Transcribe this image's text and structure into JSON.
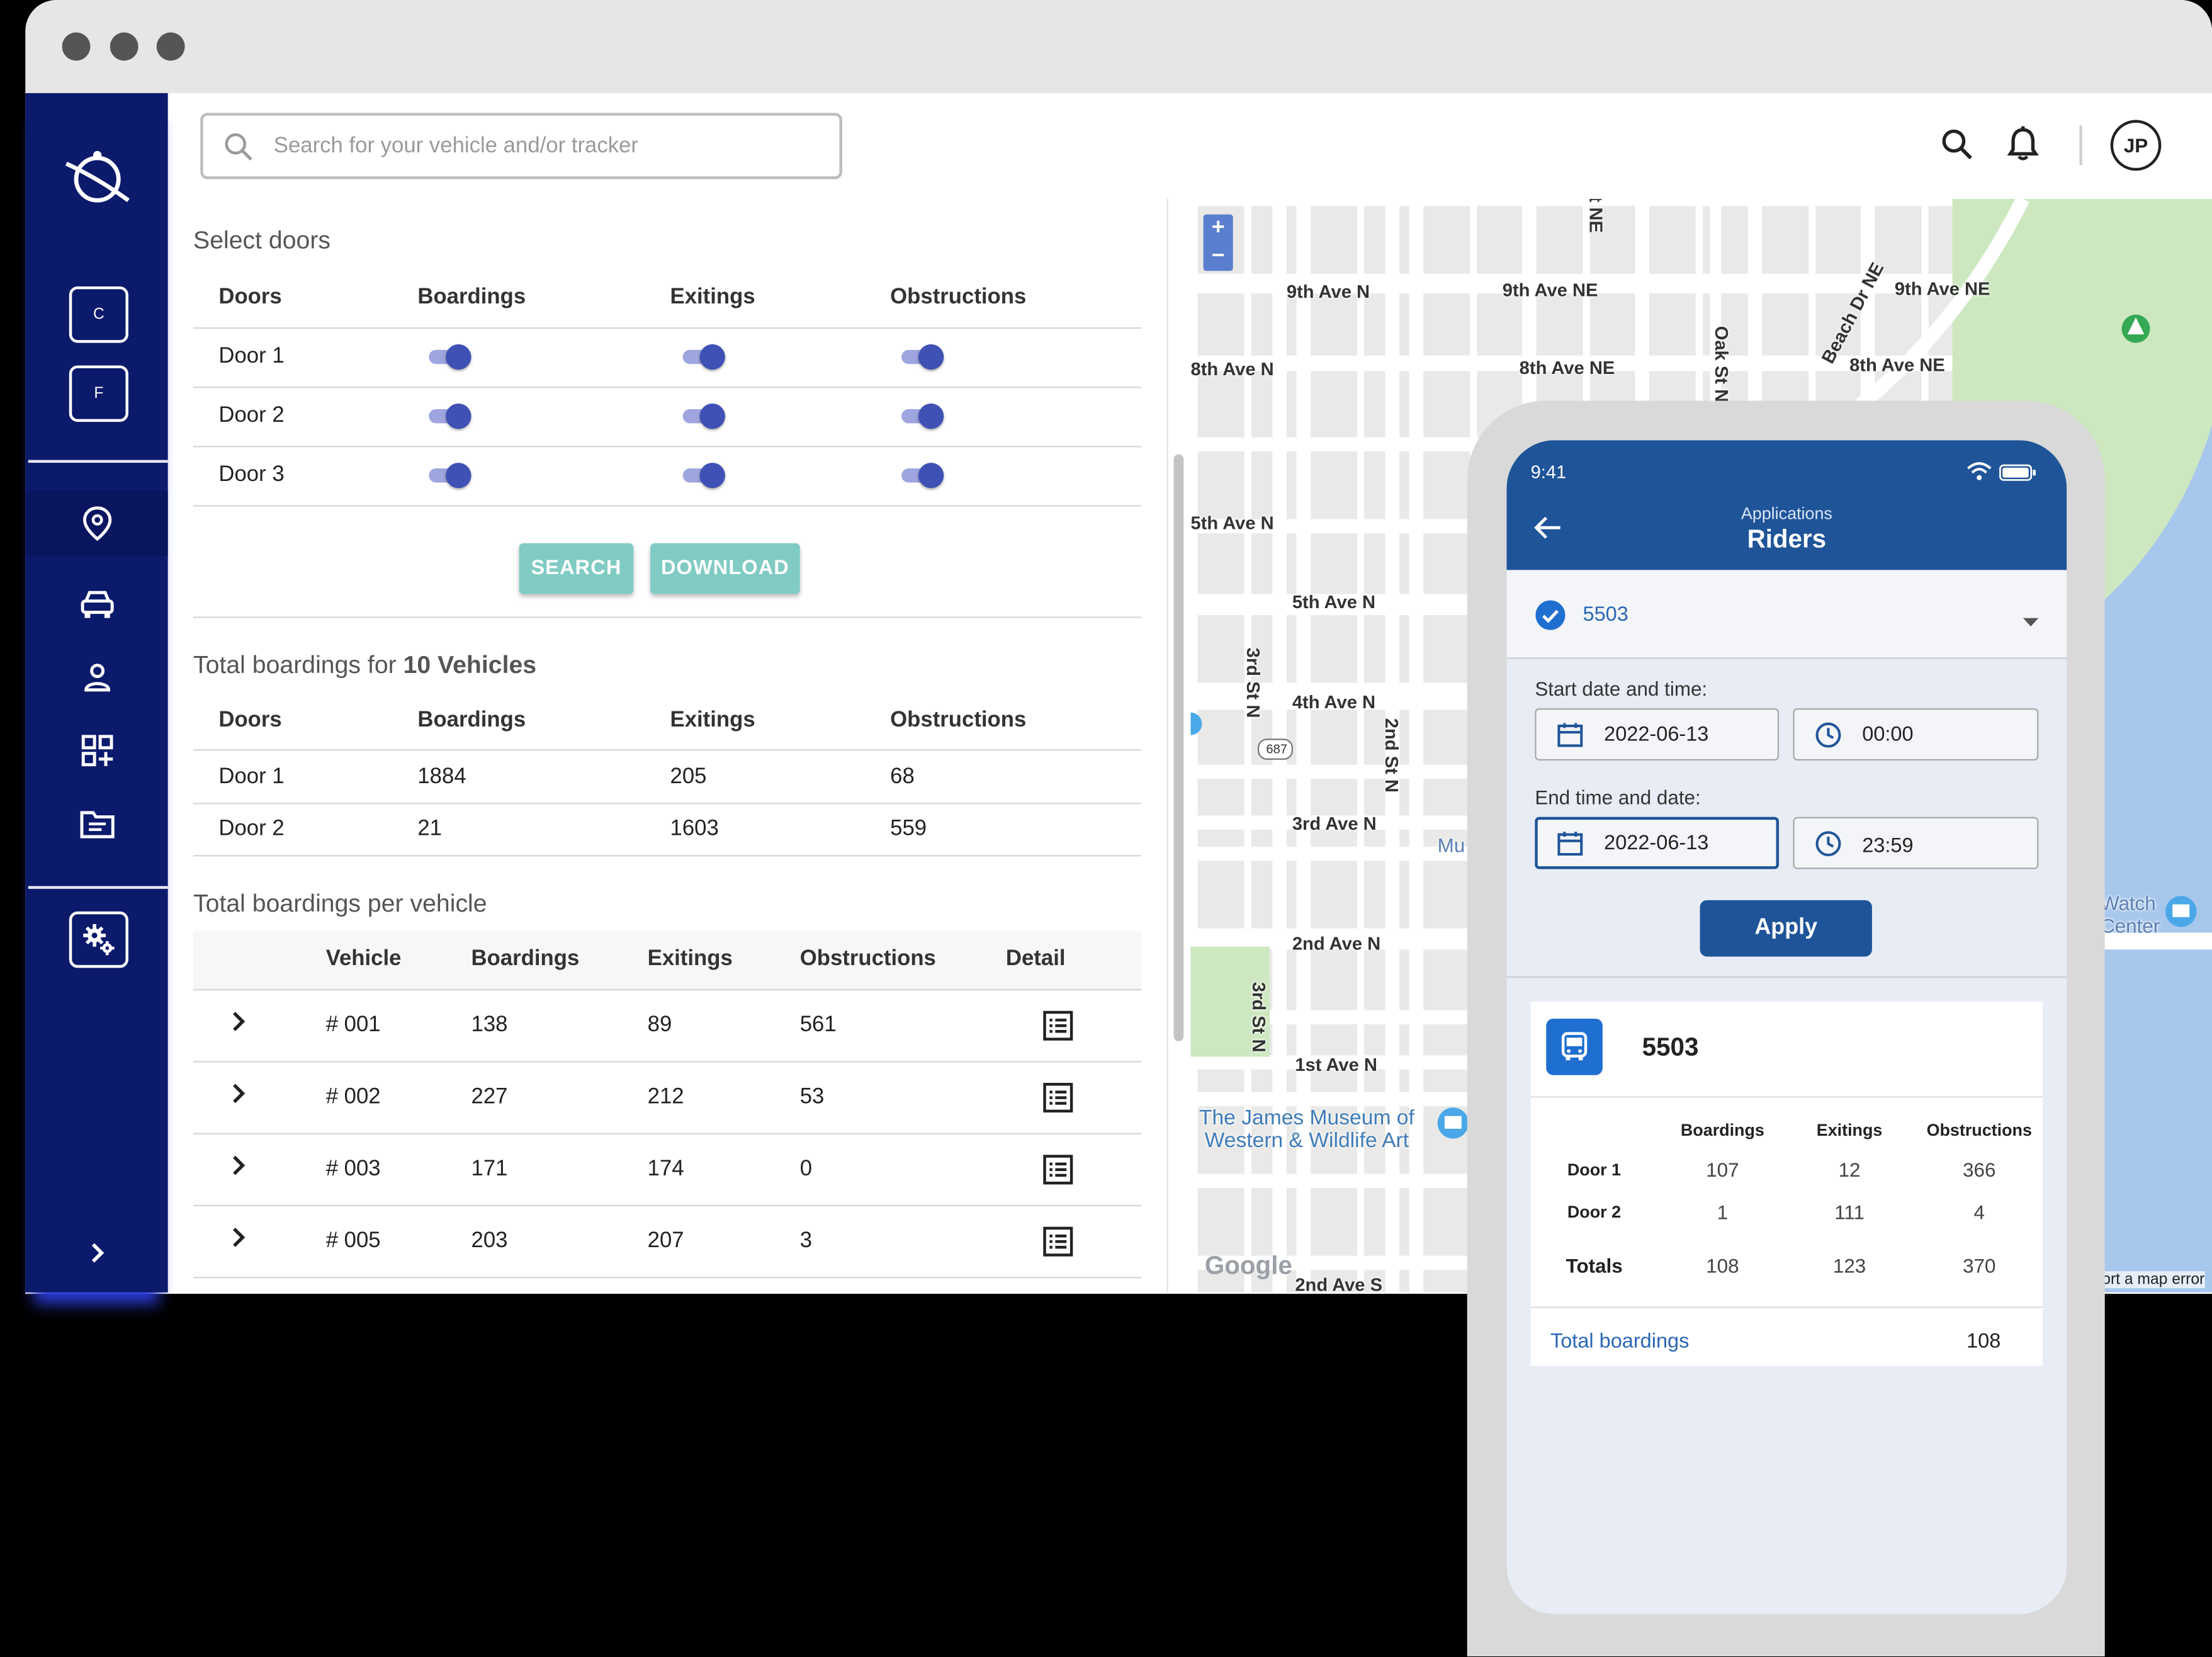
{
  "search": {
    "placeholder": "Search for your vehicle and/or tracker"
  },
  "user": {
    "initials": "JP"
  },
  "sidebar": {
    "box1": "C",
    "box2": "F",
    "items": [
      {
        "icon": "location-pin-icon"
      },
      {
        "icon": "car-icon"
      },
      {
        "icon": "person-icon"
      },
      {
        "icon": "apps-add-icon"
      },
      {
        "icon": "document-icon"
      }
    ],
    "settings_icon": "settings-gears-icon",
    "expand_icon": "chevron-right-icon"
  },
  "select_doors": {
    "title": "Select doors",
    "headers": [
      "Doors",
      "Boardings",
      "Exitings",
      "Obstructions"
    ],
    "rows": [
      {
        "door": "Door 1",
        "boardings": true,
        "exitings": true,
        "obstructions": true
      },
      {
        "door": "Door 2",
        "boardings": true,
        "exitings": true,
        "obstructions": true
      },
      {
        "door": "Door 3",
        "boardings": true,
        "exitings": true,
        "obstructions": true
      }
    ],
    "search_label": "SEARCH",
    "download_label": "DOWNLOAD"
  },
  "total_boardings": {
    "title_prefix": "Total boardings for ",
    "title_bold": "10 Vehicles",
    "headers": [
      "Doors",
      "Boardings",
      "Exitings",
      "Obstructions"
    ],
    "rows": [
      [
        "Door 1",
        "1884",
        "205",
        "68"
      ],
      [
        "Door 2",
        "21",
        "1603",
        "559"
      ]
    ]
  },
  "per_vehicle": {
    "title": "Total boardings per vehicle",
    "headers": [
      "Vehicle",
      "Boardings",
      "Exitings",
      "Obstructions",
      "Detail"
    ],
    "rows": [
      [
        "# 001",
        "138",
        "89",
        "561"
      ],
      [
        "# 002",
        "227",
        "212",
        "53"
      ],
      [
        "# 003",
        "171",
        "174",
        "0"
      ],
      [
        "# 005",
        "203",
        "207",
        "3"
      ]
    ]
  },
  "map": {
    "zoom_in": "+",
    "zoom_out": "−",
    "labels": [
      "9th Ave N",
      "9th Ave NE",
      "9th Ave NE",
      "8th Ave N",
      "8th Ave NE",
      "8th Ave NE",
      "5th Ave N",
      "5th Ave N",
      "4th Ave N",
      "3rd Ave N",
      "2nd Ave N",
      "1st Ave N",
      "3rd St N",
      "3rd St N",
      "2nd St N",
      "Oak St N",
      "Beach Dr NE",
      "t NE",
      "687",
      "Mu",
      "Watch",
      "Center",
      "2nd Ave S"
    ],
    "museum": "The James Museum of\nWestern & Wildlife Art",
    "attribution": "Google",
    "report": "ort a map error"
  },
  "phone": {
    "time": "9:41",
    "header_sub": "Applications",
    "header_title": "Riders",
    "vehicle": "5503",
    "start_label": "Start date and time:",
    "start_date": "2022-06-13",
    "start_time": "00:00",
    "end_label": "End time and date:",
    "end_date": "2022-06-13",
    "end_time": "23:59",
    "apply": "Apply",
    "card_title": "5503",
    "headers": [
      "Boardings",
      "Exitings",
      "Obstructions"
    ],
    "rows": [
      [
        "Door 1",
        "107",
        "12",
        "366"
      ],
      [
        "Door 2",
        "1",
        "111",
        "4"
      ]
    ],
    "totals": [
      "Totals",
      "108",
      "123",
      "370"
    ],
    "total_label": "Total boardings",
    "total_value": "108"
  },
  "colors": {
    "sidebar": "#0c1a6b",
    "accent": "#3f51b5",
    "teal": "#80cbc4",
    "phone_header": "#1f5499"
  }
}
